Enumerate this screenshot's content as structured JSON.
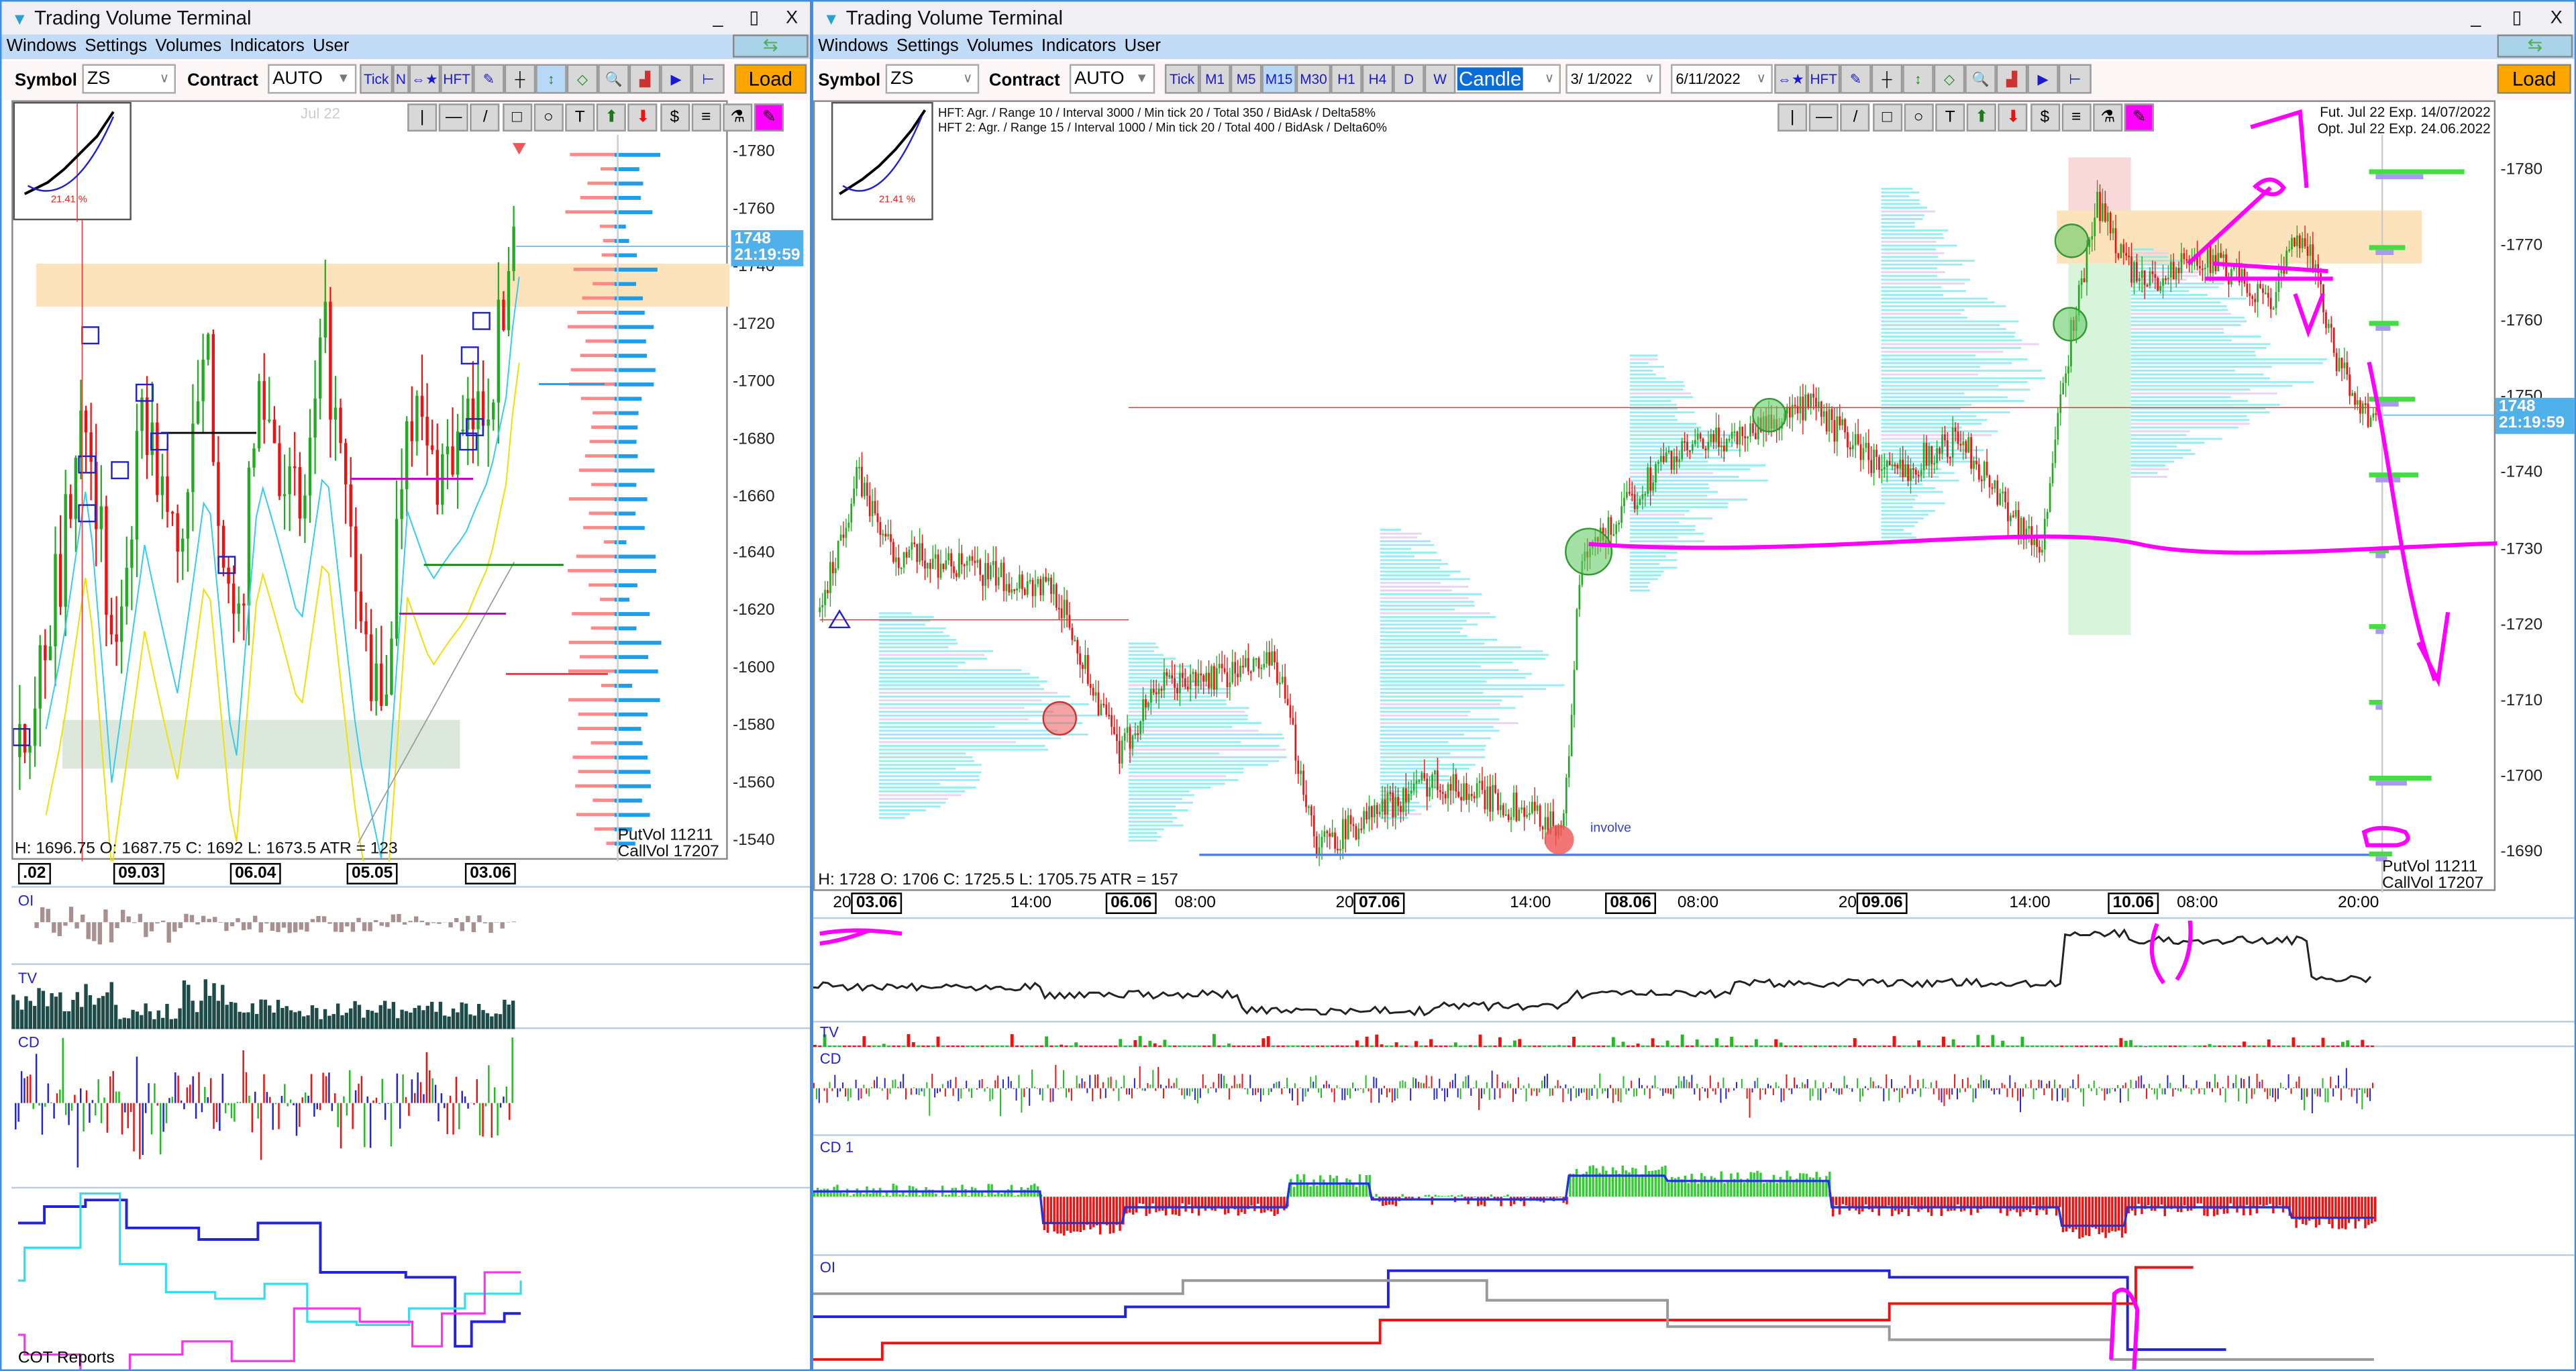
{
  "app_title": "Trading Volume Terminal",
  "window_controls": {
    "minimize": "_",
    "maximize": "▯",
    "close": "X"
  },
  "menu": [
    "Windows",
    "Settings",
    "Volumes",
    "Indicators",
    "User"
  ],
  "toolbar": {
    "symbol_label": "Symbol",
    "symbol_value": "ZS",
    "contract_label": "Contract",
    "contract_value": "AUTO",
    "load_label": "Load",
    "left_buttons": [
      "Tick",
      "N",
      "⇔★",
      "HFT"
    ],
    "timeframes": [
      "Tick",
      "M1",
      "M5",
      "M15",
      "M30",
      "H1",
      "H4",
      "D",
      "W"
    ],
    "selected_timeframe": "M15",
    "chart_type": "Candle",
    "date_from": "3/ 1/2022",
    "date_to": "6/11/2022",
    "right_buttons": [
      "⇔★",
      "HFT"
    ]
  },
  "drawing_tools": [
    "|",
    "—",
    "/",
    "□",
    "○",
    "T",
    "⬆",
    "⬇",
    "$",
    "≡",
    "⚗",
    "✎"
  ],
  "left_chart": {
    "watermark": "Jul 22",
    "thumb_percent": "21.41 %",
    "price_ticks": [
      "1780",
      "1760",
      "1740",
      "1720",
      "1700",
      "1680",
      "1660",
      "1640",
      "1620",
      "1600",
      "1580",
      "1560",
      "1540"
    ],
    "current_price": "1748",
    "current_time": "21:19:59",
    "ohlc": "H: 1696.75  O: 1687.75  C: 1692  L: 1673.5  ATR = 123",
    "put_vol": "PutVol 11211",
    "call_vol": "CallVol 17207",
    "time_labels": [
      ".02",
      "09.03",
      "06.04",
      "05.05",
      "03.06"
    ],
    "indicators": {
      "oi": "OI",
      "tv": "TV",
      "cd": "CD",
      "cot": "COT Reports"
    }
  },
  "right_chart": {
    "thumb_percent": "21.41 %",
    "hft_line1": "HFT: Agr. / Range 10 / Interval 3000 / Min tick 20 / Total 350 / BidAsk / Delta58%",
    "hft_line2": "HFT 2: Agr. / Range 15 / Interval 1000 / Min tick 20 / Total 400 / BidAsk / Delta60%",
    "fut_exp": "Fut. Jul 22 Exp. 14/07/2022",
    "opt_exp": "Opt. Jul 22 Exp. 24.06.2022",
    "price_ticks": [
      "1780",
      "1770",
      "1760",
      "1750",
      "1740",
      "1730",
      "1720",
      "1710",
      "1700",
      "1690"
    ],
    "current_price": "1748",
    "current_time": "21:19:59",
    "ohlc": "H: 1728  O: 1706  C: 1725.5  L: 1705.75  ATR = 157",
    "annotation": "involve",
    "put_vol": "PutVol  11211",
    "call_vol": "CallVol  17207",
    "time_labels": [
      {
        "t": "20",
        "b": "03.06"
      },
      {
        "t": "14:00"
      },
      {
        "b": "06.06"
      },
      {
        "t": "08:00"
      },
      {
        "t": "20",
        "b": "07.06"
      },
      {
        "t": "14:00"
      },
      {
        "b": "08.06"
      },
      {
        "t": "08:00"
      },
      {
        "t": "20",
        "b": "09.06"
      },
      {
        "t": "14:00"
      },
      {
        "b": "10.06"
      },
      {
        "t": "08:00"
      },
      {
        "t": "20:00"
      }
    ],
    "indicators": {
      "tv": "TV",
      "cd": "CD",
      "cd1": "CD 1",
      "oi": "OI"
    }
  },
  "colors": {
    "up": "#22aa22",
    "down": "#ee1111",
    "accent": "#4fb0ea",
    "load": "#ffa500",
    "annotation": "#ff00ff",
    "zone": "#fde3bc"
  }
}
